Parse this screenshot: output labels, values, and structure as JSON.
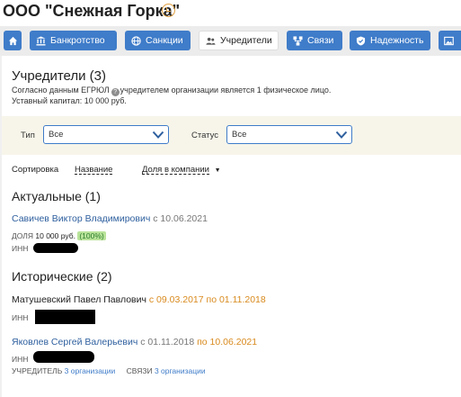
{
  "company": {
    "title": "ООО \"Снежная Горка\""
  },
  "tabs": [
    {
      "label": "Банкротство"
    },
    {
      "label": "Санкции"
    },
    {
      "label": "Учредители"
    },
    {
      "label": "Связи"
    },
    {
      "label": "Надежность"
    }
  ],
  "founders": {
    "heading": "Учредители (3)",
    "note_pre": "Согласно данным ЕГРЮЛ",
    "note_post": "учредителем организации является 1 физическое лицо.",
    "capital": "Уставный капитал: 10 000 руб."
  },
  "filters": {
    "type_label": "Тип",
    "type_value": "Все",
    "status_label": "Статус",
    "status_value": "Все"
  },
  "sort": {
    "label": "Сортировка",
    "by_name": "Название",
    "by_share": "Доля в компании"
  },
  "actual": {
    "heading": "Актуальные (1)",
    "person": {
      "name": "Савичев Виктор Владимирович",
      "since": "с 10.06.2021",
      "share_label": "ДОЛЯ",
      "share_value": "10 000 руб.",
      "share_percent": "(100%)",
      "inn_label": "ИНН"
    }
  },
  "historical": {
    "heading": "Исторические (2)",
    "people": [
      {
        "name": "Матушевский Павел Павлович",
        "period": "с 09.03.2017 по 01.11.2018",
        "inn_label": "ИНН"
      },
      {
        "name": "Яковлев Сергей Валерьевич",
        "period_from": "с 01.11.2018",
        "period_to": "по 10.06.2021",
        "inn_label": "ИНН",
        "founder_label": "УЧРЕДИТЕЛЬ",
        "founder_value": "3 организации",
        "links_label": "СВЯЗИ",
        "links_value": "3 организации"
      }
    ]
  },
  "colors": {
    "accent": "#3f7cc9",
    "orange": "#d98a1e",
    "green": "#b9e39a"
  }
}
